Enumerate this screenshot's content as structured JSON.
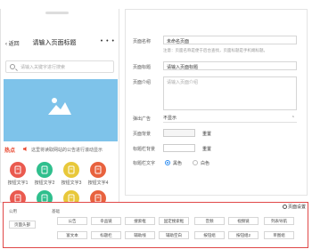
{
  "phone": {
    "nav": {
      "back_label": "返回",
      "title": "请输入页面标题",
      "more_label": "• • •"
    },
    "search": {
      "placeholder": "请输入关键字进行搜索"
    },
    "notice": {
      "tag": "热点",
      "text": "这里将读取网站的公告进行滚动显示"
    },
    "grid_items": [
      {
        "label": "按钮文字1",
        "color": "#ea5a4f"
      },
      {
        "label": "按钮文字2",
        "color": "#2fbf8d"
      },
      {
        "label": "按钮文字3",
        "color": "#e8c83a"
      },
      {
        "label": "按钮文字4",
        "color": "#e8623e"
      },
      {
        "label": "按钮文字1",
        "color": "#ea5a4f"
      },
      {
        "label": "按钮文字2",
        "color": "#2fbf8d"
      },
      {
        "label": "按钮文字3",
        "color": "#e8c83a"
      },
      {
        "label": "按钮文字4",
        "color": "#e8623e"
      }
    ],
    "banner_color": "#7ec3ea"
  },
  "settings": {
    "page_name": {
      "label": "页面名称",
      "value": "未命名页面",
      "hint": "注意：页面名称是便于后台查找，页面标题是手机端标题。"
    },
    "page_title": {
      "label": "页面标题",
      "value": "请输入页面标题"
    },
    "page_desc": {
      "label": "页面介绍",
      "placeholder": "请输入页面介绍"
    },
    "ad_popup": {
      "label": "弹出广告",
      "value": "不显示"
    },
    "bg_color": {
      "label": "页面背景",
      "reset": "重置",
      "color": "#f5f5f5"
    },
    "title_bg": {
      "label": "标题栏背景",
      "reset": "重置",
      "color": "#ffffff"
    },
    "title_text": {
      "label": "标题栏文字",
      "options": [
        "黑色",
        "白色"
      ],
      "selected": "黑色"
    }
  },
  "palette": {
    "settings_link": "页面设置",
    "general_label": "公用",
    "basic_label": "基础",
    "general_items": [
      "页面头部"
    ],
    "basic_items_row1": [
      "公告",
      "幸品链",
      "搜索框",
      "固定搜索框",
      "音频",
      "视频链",
      "列表导航"
    ],
    "basic_items_row2": [
      "富文本",
      "标题栏",
      "辅助线",
      "辅助空白",
      "按钮组",
      "按钮组2",
      "单图组"
    ]
  }
}
